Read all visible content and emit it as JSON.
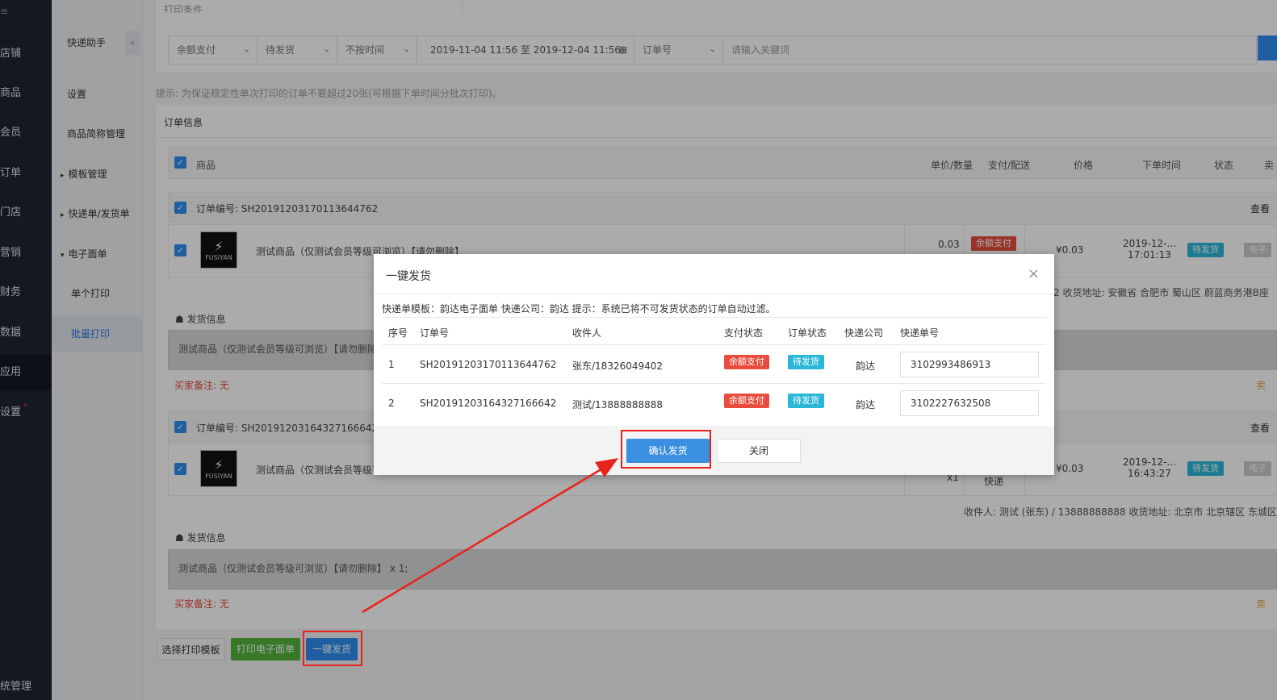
{
  "sidebar": {
    "top_icon": "menu-icon",
    "items": [
      {
        "label": "店铺"
      },
      {
        "label": "商品"
      },
      {
        "label": "会员"
      },
      {
        "label": "订单"
      },
      {
        "label": "门店"
      },
      {
        "label": "营销"
      },
      {
        "label": "财务"
      },
      {
        "label": "数据"
      },
      {
        "label": "应用"
      },
      {
        "label": "设置",
        "dot": "*"
      }
    ],
    "bottom_label": "统管理"
  },
  "subnav": {
    "title": "快递助手",
    "collapse_icon": "«",
    "items": [
      {
        "label": "设置"
      },
      {
        "label": "商品简称管理"
      },
      {
        "label": "模板管理",
        "arrow": "▸"
      },
      {
        "label": "快递单/发货单",
        "arrow": "▸"
      },
      {
        "label": "电子面单",
        "arrow": "▾"
      },
      {
        "label": "单个打印"
      },
      {
        "label": "批量打印"
      }
    ]
  },
  "page": {
    "cut_title": "打印条件",
    "filters": {
      "payment": "余额支付",
      "ship_status": "待发货",
      "time_mode": "不按时间",
      "date_range": "2019-11-04 11:56 至 2019-12-04 11:56",
      "search_type": "订单号",
      "keyword_placeholder": "请输入关键词"
    },
    "hint": "提示: 为保证稳定性单次打印的订单不要超过20张(可根据下单时间分批次打印)。",
    "section_title": "订单信息",
    "table_headers": {
      "product": "商品",
      "unit_qty": "单价/数量",
      "pay_ship": "支付/配送",
      "price": "价格",
      "order_time": "下单时间",
      "status": "状态",
      "extra": "卖"
    },
    "orders": [
      {
        "order_no_label": "订单编号: SH20191203170113644762",
        "right_link": "查看",
        "product_name": "测试商品（仅测试会员等级可浏览）【请勿删除】",
        "unit_price": "0.03",
        "pay_badge": "余额支付",
        "price": "¥0.03",
        "time_line1": "2019-12-...",
        "time_line2": "17:01:13",
        "status_badge": "待发货",
        "extra_badge": "电子",
        "address": "2 收货地址: 安徽省 合肥市 蜀山区 蔚蓝商务港B座",
        "ship_title": "发货信息",
        "ship_items": "测试商品（仅测试会员等级可浏览）【请勿删除】",
        "remark": "买家备注: 无",
        "right_side": "卖"
      },
      {
        "order_no_label": "订单编号: SH20191203164327166642",
        "right_link": "查看",
        "product_name": "测试商品（仅测试会员等级可浏览）【请勿删除】",
        "qty": "x1",
        "ship_method": "快递",
        "price": "¥0.03",
        "time_line1": "2019-12-...",
        "time_line2": "16:43:27",
        "status_badge": "待发货",
        "extra_badge": "电子",
        "address": "收件人: 测试 (张东) / 13888888888 收货地址: 北京市 北京辖区 东城区",
        "ship_title": "发货信息",
        "ship_items": "测试商品（仅测试会员等级可浏览）【请勿删除】 x 1;",
        "remark": "买家备注: 无",
        "right_side": "卖"
      }
    ],
    "logo_text": "FUSIYAN",
    "logo_symbol": "⚡",
    "footer_buttons": {
      "select_template": "选择打印模板",
      "print_waybill": "打印电子面单",
      "one_click_ship": "一键发货"
    }
  },
  "modal": {
    "title": "一键发货",
    "close": "×",
    "info": "快递单模板：韵达电子面单 快递公司：韵达 提示：系统已将不可发货状态的订单自动过滤。",
    "headers": {
      "no": "序号",
      "order_no": "订单号",
      "receiver": "收件人",
      "pay_status": "支付状态",
      "order_status": "订单状态",
      "courier": "快递公司",
      "tracking": "快递单号"
    },
    "rows": [
      {
        "no": "1",
        "order_no": "SH20191203170113644762",
        "receiver": "张东/18326049402",
        "pay_status": "余额支付",
        "order_status": "待发货",
        "courier": "韵达",
        "tracking": "3102993486913"
      },
      {
        "no": "2",
        "order_no": "SH20191203164327166642",
        "receiver": "测试/13888888888",
        "pay_status": "余额支付",
        "order_status": "待发货",
        "courier": "韵达",
        "tracking": "3102227632508"
      }
    ],
    "confirm": "确认发货",
    "cancel": "关闭"
  },
  "colors": {
    "accent": "#2d8cf0",
    "badge_red": "#e74c3c",
    "badge_cyan": "#2bb8d8",
    "annotation_red": "#e8231b",
    "print_green": "#52b33e"
  }
}
